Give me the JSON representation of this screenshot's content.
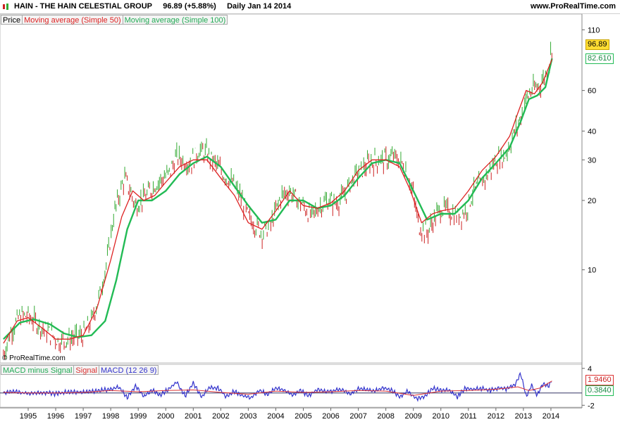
{
  "header": {
    "ticker": "HAIN - THE HAIN CELESTIAL GROUP",
    "price_change": "96.89 (+5.88%)",
    "period_date": "Daily  Jan 14 2014",
    "site": "www.ProRealTime.com"
  },
  "legend_main": {
    "price": "Price",
    "ma50": "Moving average (Simple 50)",
    "ma100": "Moving average (Simple 100)"
  },
  "legend_macd": {
    "hist": "MACD minus Signal",
    "signal": "Signal",
    "macd": "MACD (12 26 9)"
  },
  "copyright": "© ProRealTime.com",
  "badges": {
    "last_price": "96.89",
    "ma100_value": "82.610",
    "signal_value": "1.9460",
    "hist_value": "0.3840"
  },
  "colors": {
    "price_up": "#33aa33",
    "price_down": "#cc2222",
    "ma50": "#dd2222",
    "ma100": "#22bb55",
    "signal": "#dd3333",
    "macd": "#3333cc",
    "badge_price_bg": "#ffdd33"
  },
  "chart_data": [
    {
      "type": "line",
      "scale": "log",
      "x_ticks": [
        "1995",
        "1996",
        "1997",
        "1998",
        "1999",
        "2000",
        "2001",
        "2002",
        "2003",
        "2004",
        "2005",
        "2006",
        "2007",
        "2008",
        "2009",
        "2010",
        "2011",
        "2012",
        "2013",
        "2014"
      ],
      "y_ticks": [
        "110",
        "60",
        "40",
        "30",
        "20",
        "10"
      ],
      "ylim": [
        4,
        120
      ],
      "series": [
        {
          "name": "Price",
          "x": [
            1994.1,
            1994.4,
            1994.7,
            1995.0,
            1995.3,
            1995.6,
            1995.9,
            1996.1,
            1996.4,
            1996.7,
            1997.0,
            1997.3,
            1997.6,
            1997.9,
            1998.1,
            1998.3,
            1998.5,
            1998.7,
            1998.9,
            1999.1,
            1999.3,
            1999.6,
            1999.9,
            2000.1,
            2000.4,
            2000.6,
            2000.9,
            2001.2,
            2001.5,
            2001.8,
            2002.1,
            2002.4,
            2002.7,
            2003.0,
            2003.2,
            2003.5,
            2003.8,
            2004.0,
            2004.2,
            2004.5,
            2004.8,
            2005.0,
            2005.3,
            2005.6,
            2005.9,
            2006.2,
            2006.5,
            2006.8,
            2007.1,
            2007.4,
            2007.7,
            2008.0,
            2008.3,
            2008.6,
            2008.8,
            2009.0,
            2009.2,
            2009.5,
            2009.8,
            2010.0,
            2010.3,
            2010.6,
            2010.9,
            2011.2,
            2011.5,
            2011.8,
            2012.0,
            2012.3,
            2012.5,
            2012.7,
            2012.9,
            2013.1,
            2013.3,
            2013.5,
            2013.7,
            2013.9,
            2014.04
          ],
          "y": [
            4.3,
            5.5,
            6.3,
            6.3,
            5.9,
            5.5,
            5.2,
            4.9,
            5.0,
            5.1,
            5.2,
            6.0,
            7.8,
            11.5,
            17,
            21,
            25,
            22,
            19,
            20,
            21,
            23.5,
            25,
            26,
            31,
            30,
            29,
            33,
            32,
            29,
            26,
            24,
            21,
            17,
            16,
            14.5,
            15.5,
            18,
            21,
            22,
            20,
            19,
            17,
            19,
            20,
            19.5,
            21,
            25,
            27,
            29,
            30,
            30,
            31,
            29,
            26,
            21,
            15.5,
            14.5,
            17,
            18.5,
            18,
            17,
            18,
            22,
            24,
            27,
            30,
            31,
            35,
            40,
            46,
            55,
            60,
            62,
            66,
            75,
            94
          ]
        },
        {
          "name": "Moving average (Simple 50)",
          "x": [
            1994.1,
            1994.6,
            1995.0,
            1995.5,
            1996.0,
            1996.5,
            1997.0,
            1997.5,
            1998.0,
            1998.4,
            1998.8,
            1999.2,
            1999.6,
            2000.0,
            2000.5,
            2001.0,
            2001.5,
            2002.0,
            2002.5,
            2003.0,
            2003.5,
            2004.0,
            2004.5,
            2005.0,
            2005.5,
            2006.0,
            2006.5,
            2007.0,
            2007.5,
            2008.0,
            2008.5,
            2008.9,
            2009.3,
            2009.7,
            2010.0,
            2010.5,
            2011.0,
            2011.5,
            2012.0,
            2012.5,
            2012.8,
            2013.1,
            2013.4,
            2013.7,
            2014.04
          ],
          "y": [
            4.8,
            6.0,
            6.2,
            5.6,
            5.0,
            5.0,
            5.2,
            6.8,
            11,
            17,
            22,
            20,
            21,
            24,
            28,
            30,
            30,
            25,
            21,
            16,
            15,
            18,
            22,
            19,
            18.5,
            19.5,
            22,
            27,
            30,
            30,
            28,
            22,
            16,
            17.5,
            18,
            18.5,
            22,
            27,
            31,
            38,
            48,
            60,
            58,
            65,
            82
          ]
        },
        {
          "name": "Moving average (Simple 100)",
          "x": [
            1994.1,
            1994.7,
            1995.2,
            1995.8,
            1996.3,
            1996.8,
            1997.3,
            1997.8,
            1998.2,
            1998.6,
            1999.0,
            1999.5,
            2000.0,
            2000.5,
            2001.0,
            2001.5,
            2002.0,
            2002.5,
            2003.0,
            2003.5,
            2004.0,
            2004.5,
            2005.0,
            2005.5,
            2006.0,
            2006.5,
            2007.0,
            2007.5,
            2008.0,
            2008.5,
            2009.0,
            2009.5,
            2010.0,
            2010.5,
            2011.0,
            2011.5,
            2012.0,
            2012.5,
            2012.9,
            2013.2,
            2013.5,
            2013.8,
            2014.04
          ],
          "y": [
            5.0,
            5.9,
            6.1,
            5.8,
            5.3,
            5.1,
            5.2,
            6.0,
            9,
            15,
            20,
            20,
            22,
            26,
            29,
            31,
            28,
            23,
            19,
            16,
            16.5,
            20,
            20,
            18.5,
            19,
            21,
            25,
            29,
            30,
            29,
            22,
            16.5,
            17.5,
            17.5,
            20,
            25,
            29,
            34,
            44,
            55,
            57,
            62,
            82.6
          ]
        }
      ]
    },
    {
      "type": "line",
      "title": "MACD (12 26 9)",
      "y_ticks": [
        "4",
        "-2"
      ],
      "ylim": [
        -2.2,
        4.2
      ],
      "series": [
        {
          "name": "MACD (12 26 9)",
          "x": [
            1994.1,
            1994.5,
            1995.0,
            1995.5,
            1996.0,
            1996.5,
            1997.0,
            1997.5,
            1998.0,
            1998.3,
            1998.6,
            1998.9,
            1999.2,
            1999.5,
            1999.8,
            2000.1,
            2000.4,
            2000.7,
            2001.0,
            2001.3,
            2001.6,
            2001.9,
            2002.2,
            2002.5,
            2002.8,
            2003.1,
            2003.4,
            2003.7,
            2004.0,
            2004.3,
            2004.6,
            2004.9,
            2005.2,
            2005.5,
            2005.8,
            2006.1,
            2006.4,
            2006.7,
            2007.0,
            2007.3,
            2007.6,
            2007.9,
            2008.2,
            2008.5,
            2008.8,
            2009.1,
            2009.4,
            2009.7,
            2010.0,
            2010.3,
            2010.6,
            2010.9,
            2011.2,
            2011.5,
            2011.8,
            2012.1,
            2012.4,
            2012.7,
            2012.9,
            2013.1,
            2013.3,
            2013.5,
            2013.7,
            2013.9,
            2014.04
          ],
          "y": [
            0.1,
            0.2,
            -0.1,
            0.1,
            -0.1,
            0.2,
            0.1,
            0.3,
            0.6,
            1.0,
            -0.8,
            1.2,
            -0.6,
            0.5,
            -0.3,
            0.6,
            1.8,
            -0.5,
            1.6,
            -0.7,
            0.9,
            0.8,
            -0.6,
            0.3,
            -0.5,
            -0.8,
            0.4,
            -0.3,
            0.8,
            0.5,
            -0.4,
            0.4,
            -0.5,
            0.6,
            0.2,
            0.4,
            0.6,
            -0.2,
            0.7,
            0.5,
            0.3,
            0.9,
            0.5,
            -0.6,
            0.3,
            -0.9,
            -0.6,
            0.7,
            0.5,
            0.4,
            -0.6,
            0.8,
            0.6,
            0.7,
            0.4,
            0.9,
            0.7,
            1.4,
            3.2,
            -0.6,
            1.3,
            -0.4,
            1.5,
            1.1,
            2.0
          ]
        },
        {
          "name": "Signal",
          "x": [
            1994.1,
            1995.0,
            1996.0,
            1997.0,
            1998.0,
            1999.0,
            2000.0,
            2001.0,
            2002.0,
            2003.0,
            2004.0,
            2005.0,
            2006.0,
            2007.0,
            2008.0,
            2009.0,
            2010.0,
            2011.0,
            2012.0,
            2012.8,
            2013.2,
            2013.6,
            2014.04
          ],
          "y": [
            0.1,
            0.0,
            0.0,
            0.1,
            0.4,
            0.2,
            0.4,
            0.5,
            0.1,
            -0.2,
            0.3,
            0.1,
            0.2,
            0.4,
            0.3,
            -0.4,
            0.3,
            0.4,
            0.6,
            1.0,
            0.4,
            0.8,
            1.946
          ]
        }
      ]
    }
  ]
}
